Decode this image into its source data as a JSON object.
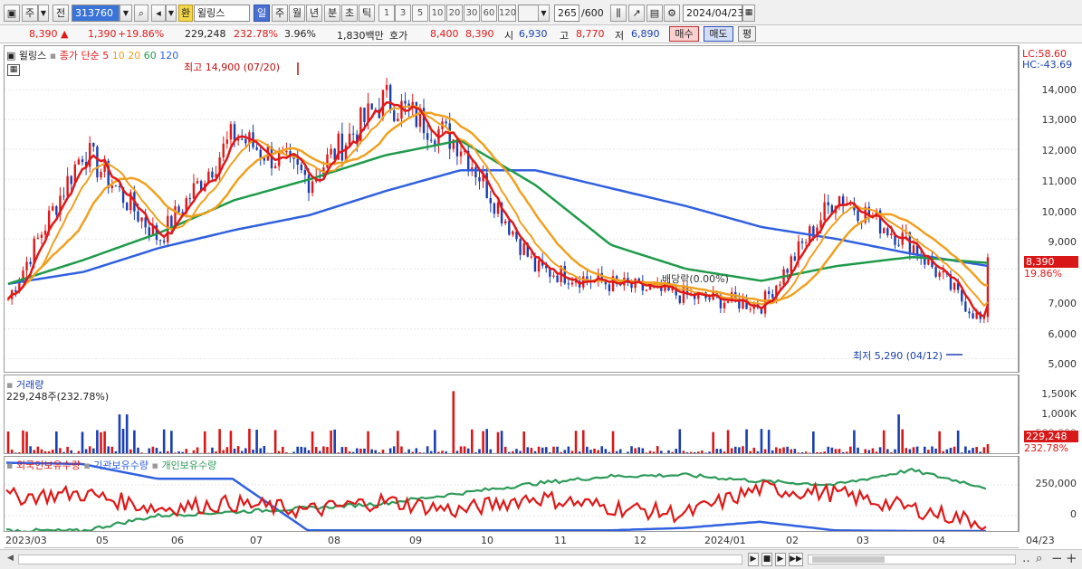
{
  "toolbar": {
    "type_label": "주",
    "prev_label": "전",
    "code": "313760",
    "currency_badge": "환",
    "stock_name": "윌링스",
    "period_buttons": [
      "일",
      "주",
      "월",
      "년",
      "분",
      "초",
      "틱"
    ],
    "active_period": "일",
    "interval_buttons": [
      "1",
      "3",
      "5",
      "10",
      "20",
      "30",
      "60",
      "120"
    ],
    "count_value": "265",
    "count_max": "/600",
    "date": "2024/04/23"
  },
  "quote": {
    "price": "8,390",
    "change_arrow": "▲",
    "change": "1,390",
    "change_pct": "+19.86%",
    "volume": "229,248",
    "volume_ratio": "232.78%",
    "turnover": "3.96%",
    "amount": "1,830백만",
    "bid_label": "호가",
    "bid1": "8,400",
    "bid2": "8,390",
    "open_label": "시",
    "open": "6,930",
    "high_label": "고",
    "high": "8,770",
    "low_label": "저",
    "low": "6,890",
    "buy_label": "매수",
    "sell_label": "매도",
    "eval_label": "평"
  },
  "price_panel": {
    "name": "윌링스",
    "ma_label": "종가 단순",
    "ma_periods": [
      "5",
      "10",
      "20",
      "60",
      "120"
    ],
    "ma_colors": [
      "#e01818",
      "#f0a020",
      "#f0a020",
      "#1f9a4a",
      "#3060e0"
    ],
    "high_annotation": "최고 14,900 (07/20)",
    "low_annotation": "최저 5,290 (04/12)",
    "dividend_annotation": "배당락(0.00%)",
    "lc": "LC:58.60",
    "hc": "HC:-43.69",
    "y_ticks": [
      "14,000",
      "13,000",
      "12,000",
      "11,000",
      "10,000",
      "9,000",
      "8,000",
      "7,000",
      "6,000",
      "5,000"
    ],
    "last_price_tag": "8,390",
    "last_change_tag": "19.86%"
  },
  "volume_panel": {
    "title": "거래량",
    "value_label": "229,248주(232.78%)",
    "y_ticks": [
      "1,500K",
      "1,000K",
      "500,000"
    ],
    "last_tag": "229,248",
    "last_pct_tag": "232.78%"
  },
  "holding_panel": {
    "series": [
      "외국인보유수량",
      "기관보유수량",
      "개인보유수량"
    ],
    "colors": [
      "#e01818",
      "#3060e0",
      "#2e9a5a"
    ],
    "y_ticks": [
      "250,000",
      "0"
    ]
  },
  "x_axis": [
    "2023/03",
    "05",
    "06",
    "07",
    "08",
    "09",
    "10",
    "11",
    "12",
    "2024/01",
    "02",
    "03",
    "04",
    "04/23"
  ],
  "chart_data": {
    "type": "line",
    "y_range": [
      4800,
      15000
    ],
    "close_approx": {
      "x": [
        "2023/03",
        "2023/04",
        "2023/05",
        "2023/06",
        "2023/07",
        "2023/08",
        "2023/09",
        "2023/10",
        "2023/11",
        "2023/12",
        "2024/01",
        "2024/02",
        "2024/03",
        "2024/04"
      ],
      "values": [
        7000,
        12000,
        9000,
        12500,
        11000,
        13700,
        12200,
        8000,
        7500,
        7100,
        6800,
        10500,
        8800,
        6000
      ]
    },
    "ma120_approx": [
      7500,
      7900,
      8700,
      9300,
      9800,
      10600,
      11300,
      11300,
      10700,
      10100,
      9400,
      9000,
      8500,
      8100
    ],
    "ma60_approx": [
      7500,
      8300,
      9200,
      10300,
      11000,
      11800,
      12300,
      10800,
      8800,
      8000,
      7600,
      8100,
      8400,
      8200
    ],
    "last_close": 8390,
    "period_high": 14900,
    "period_low": 5290
  }
}
